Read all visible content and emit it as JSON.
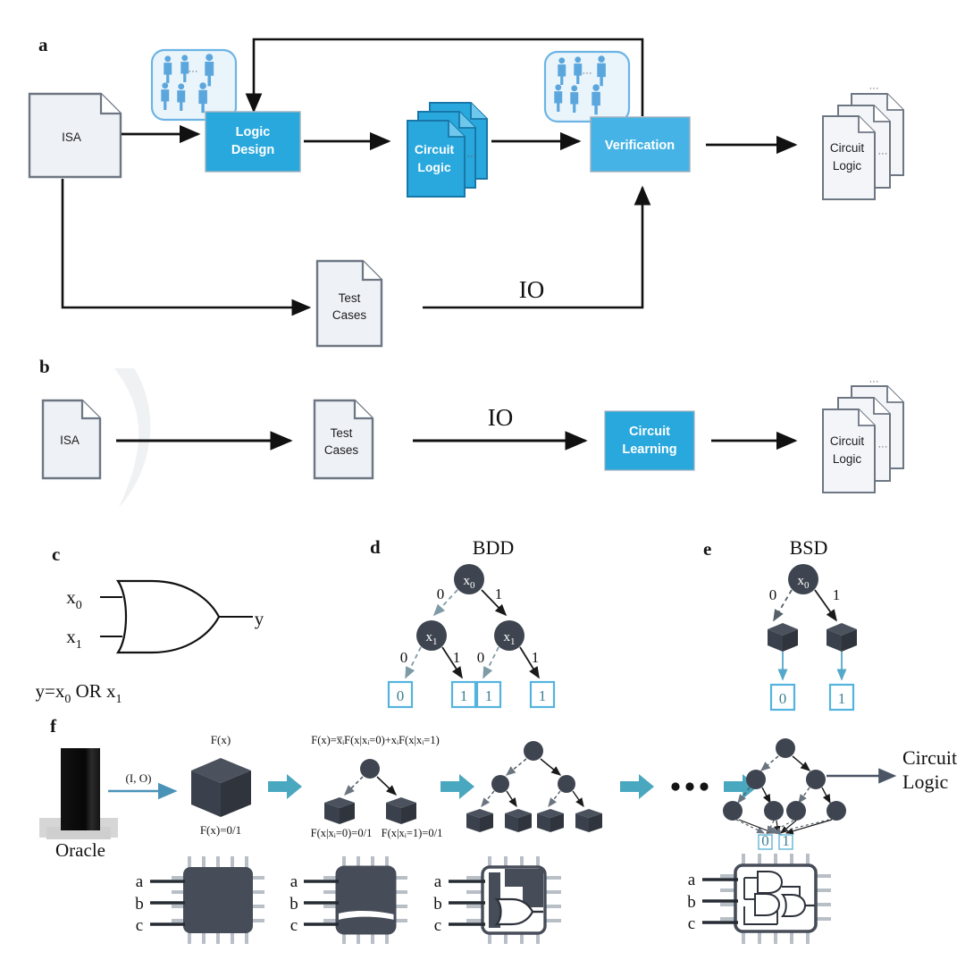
{
  "figure": {
    "panels": [
      "a",
      "b",
      "c",
      "d",
      "e",
      "f"
    ]
  },
  "panel_a": {
    "letter": "a",
    "isa_doc": "ISA",
    "logic_design_box": "Logic\nDesign",
    "logic_design_line1": "Logic",
    "logic_design_line2": "Design",
    "circuit_logic_blue_line1": "Circuit",
    "circuit_logic_blue_line2": "Logic",
    "verification_box": "Verification",
    "circuit_logic_gray_line1": "Circuit",
    "circuit_logic_gray_line2": "Logic",
    "test_cases_line1": "Test",
    "test_cases_line2": "Cases",
    "io_label": "IO",
    "people_icon_count": 6,
    "ellipsis": "...",
    "colors": {
      "accent_blue": "#29a8dd",
      "people_fill": "#5ba7dd",
      "people_bg": "#eaf4fb",
      "doc_fill": "#eef2f7",
      "doc_stroke": "#6d7682",
      "arrow": "#111111"
    }
  },
  "panel_b": {
    "letter": "b",
    "isa_doc": "ISA",
    "test_cases_line1": "Test",
    "test_cases_line2": "Cases",
    "io_label": "IO",
    "circuit_learning_line1": "Circuit",
    "circuit_learning_line2": "Learning",
    "circuit_logic_line1": "Circuit",
    "circuit_logic_line2": "Logic",
    "ellipsis": "..."
  },
  "panel_c": {
    "letter": "c",
    "input_0": "x",
    "input_0_sub": "0",
    "input_1": "x",
    "input_1_sub": "1",
    "output": "y",
    "equation_prefix": "y=x",
    "equation_sub0": "0",
    "equation_mid": " OR x",
    "equation_sub1": "1",
    "gate_type": "OR"
  },
  "panel_d": {
    "letter": "d",
    "title": "BDD",
    "root_label": "x",
    "root_sub": "0",
    "level1_label": "x",
    "level1_sub": "1",
    "edge_labels": [
      "0",
      "1",
      "0",
      "1",
      "0",
      "1"
    ],
    "leaves": [
      "0",
      "1",
      "1",
      "1"
    ]
  },
  "panel_e": {
    "letter": "e",
    "title": "BSD",
    "root_label": "x",
    "root_sub": "0",
    "edge_labels": [
      "0",
      "1"
    ],
    "leaves": [
      "0",
      "1"
    ],
    "oracle_cube_count": 2
  },
  "panel_f": {
    "letter": "f",
    "oracle_label": "Oracle",
    "io_arrow_label": "(I, O)",
    "step1_top": "F(x)",
    "step1_bottom": "F(x)=0/1",
    "step2_formula": "F(x)=x̅ᵢF(x|xᵢ=0)+xᵢF(x|xᵢ=1)",
    "step2_formula_plain": "F(x)=xiF(x|xi=0)+xiF(x|xi=1)",
    "step2_left_label": "F(x|xᵢ=0)=0/1",
    "step2_right_label": "F(x|xᵢ=1)=0/1",
    "ellipsis_dots": "•••",
    "final_leaves": [
      "0",
      "1"
    ],
    "output_label_line1": "Circuit",
    "output_label_line2": "Logic",
    "chip_pins": [
      "a",
      "b",
      "c"
    ],
    "chip_count": 4,
    "colors": {
      "teal_arrow": "#4aa6bd",
      "cube_dark": "#3f4550",
      "chip_body": "#464c58",
      "chip_pin": "#b9bfc7"
    }
  }
}
